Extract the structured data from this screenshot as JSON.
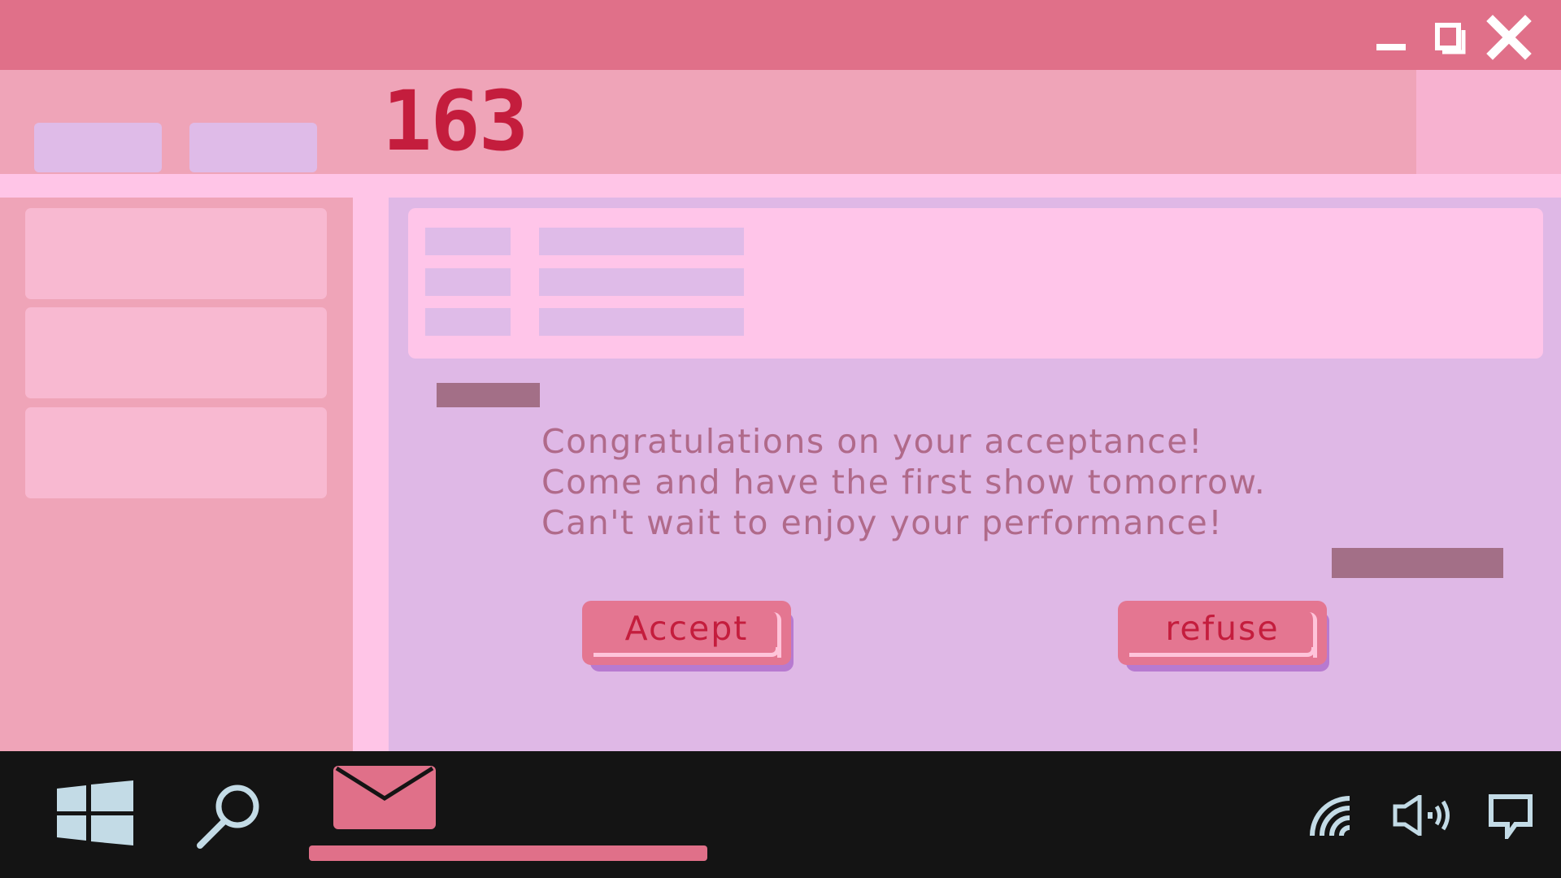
{
  "window": {
    "controls": [
      "minimize-icon",
      "maximize-icon",
      "close-icon"
    ],
    "title_color": "#e07089"
  },
  "header": {
    "counter": "163"
  },
  "message": {
    "lines": [
      "Congratulations on your acceptance!",
      "Come and have the first show tomorrow.",
      "Can't wait to enjoy your performance!"
    ]
  },
  "actions": {
    "accept_label": "Accept",
    "refuse_label": "refuse"
  },
  "taskbar": {
    "left_icons": [
      "windows-icon",
      "search-icon",
      "mail-icon"
    ],
    "right_icons": [
      "wifi-icon",
      "speaker-icon",
      "notification-icon"
    ],
    "active_app": "mail"
  },
  "colors": {
    "accent": "#e07089",
    "text_red": "#c41d3d",
    "message_text": "#b06a8a",
    "taskbar_bg": "#141414",
    "icon_light": "#c3dbe6"
  }
}
